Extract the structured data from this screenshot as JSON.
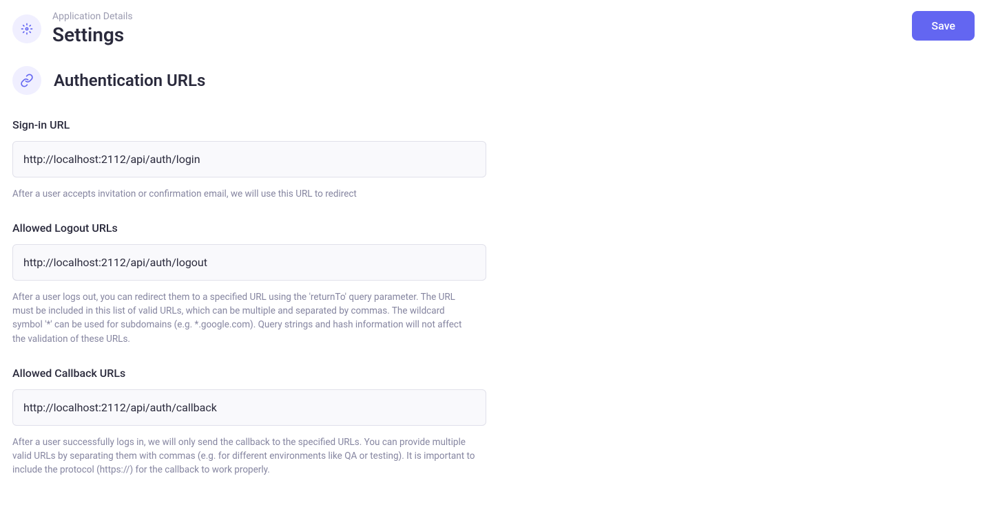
{
  "header": {
    "breadcrumb": "Application Details",
    "title": "Settings",
    "save_label": "Save"
  },
  "section": {
    "title": "Authentication URLs"
  },
  "fields": {
    "signin": {
      "label": "Sign-in URL",
      "value": "http://localhost:2112/api/auth/login",
      "help": "After a user accepts invitation or confirmation email, we will use this URL to redirect"
    },
    "logout": {
      "label": "Allowed Logout URLs",
      "value": "http://localhost:2112/api/auth/logout",
      "help": "After a user logs out, you can redirect them to a specified URL using the 'returnTo' query parameter. The URL must be included in this list of valid URLs, which can be multiple and separated by commas. The wildcard symbol '*' can be used for subdomains (e.g. *.google.com). Query strings and hash information will not affect the validation of these URLs."
    },
    "callback": {
      "label": "Allowed Callback URLs",
      "value": "http://localhost:2112/api/auth/callback",
      "help": "After a user successfully logs in, we will only send the callback to the specified URLs. You can provide multiple valid URLs by separating them with commas (e.g. for different environments like QA or testing). It is important to include the protocol (https://) for the callback to work properly."
    }
  }
}
